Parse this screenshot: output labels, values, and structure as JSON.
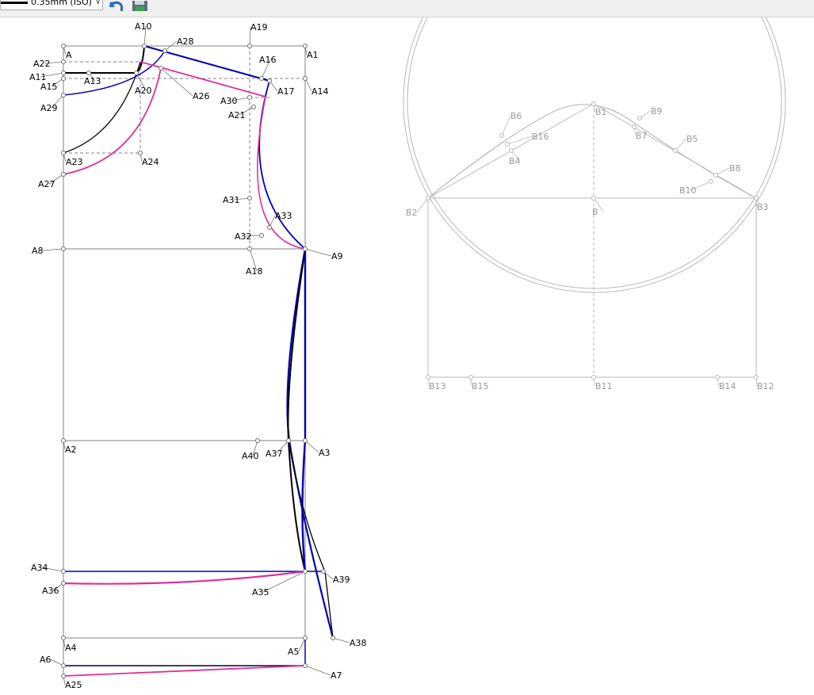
{
  "toolbar": {
    "line_weight": "0.35mm (ISO)",
    "undo_icon": "undo-arrow-icon",
    "save_icon": "floppy-disk-icon"
  },
  "colors": {
    "outline": "#000000",
    "front": "#0000b4",
    "back": "#e0309a",
    "construction": "#808080",
    "sleeve": "#b8b8b8"
  },
  "pattern_points": [
    "A",
    "A1",
    "A2",
    "A3",
    "A4",
    "A5",
    "A6",
    "A7",
    "A8",
    "A9",
    "A10",
    "A11",
    "A13",
    "A14",
    "A15",
    "A16",
    "A17",
    "A18",
    "A19",
    "A20",
    "A21",
    "A22",
    "A23",
    "A24",
    "A25",
    "A26",
    "A27",
    "A28",
    "A29",
    "A30",
    "A31",
    "A32",
    "A33",
    "A34",
    "A35",
    "A36",
    "A37",
    "A38",
    "A39",
    "A40"
  ],
  "sleeve_points": [
    "B",
    "B1",
    "B2",
    "B3",
    "B4",
    "B5",
    "B6",
    "B7",
    "B8",
    "B9",
    "B10",
    "B11",
    "B12",
    "B13",
    "B14",
    "B15",
    "B16"
  ]
}
